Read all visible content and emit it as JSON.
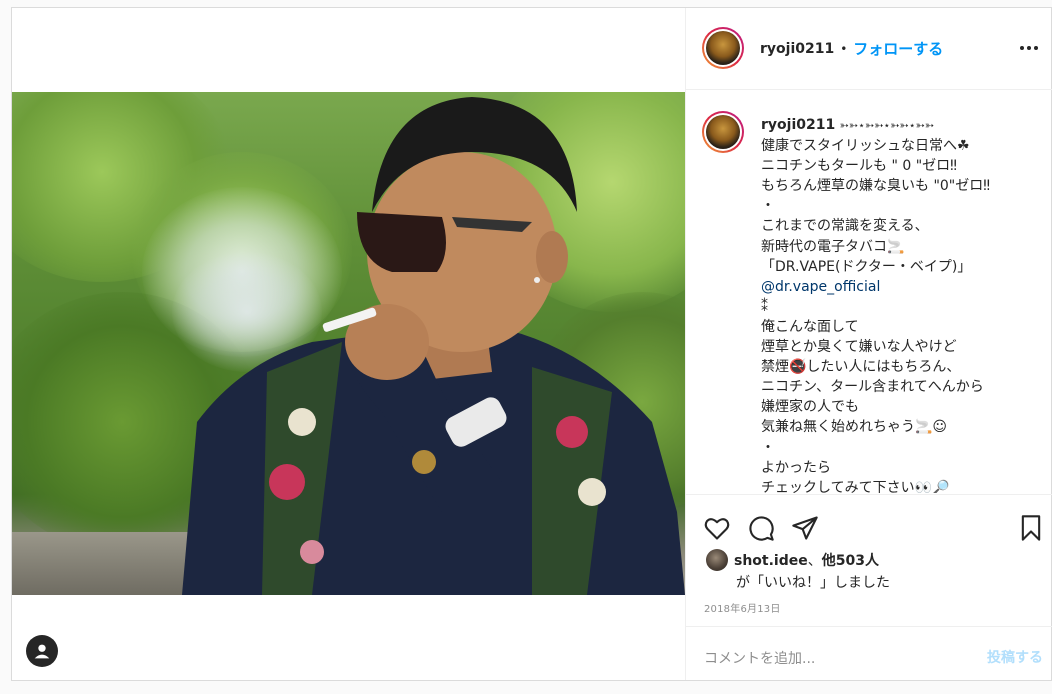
{
  "post": {
    "username": "ryoji0211",
    "header_separator": "•",
    "follow_label": "フォローする",
    "caption_username": "ryoji0211",
    "caption_lines": [
      "➳➳⋆➳➳⋆➳➳⋆➳➳",
      "健康でスタイリッシュな日常へ☘",
      "ニコチンもタールも \" 0 \"ゼロ‼",
      "もちろん煙草の嫌な臭いも \"0\"ゼロ‼",
      "・",
      "これまでの常識を変える、",
      "新時代の電子タバコ🚬",
      "「DR.VAPE(ドクター・ベイプ)」",
      "@dr.vape_official",
      "⁑",
      "俺こんな面して",
      "煙草とか臭くて嫌いな人やけど",
      "禁煙🚭したい人にはもちろん、",
      "ニコチン、タール含まれてへんから",
      "嫌煙家の人でも",
      "気兼ね無く始めれちゃう🚬☺",
      "・",
      "よかったら",
      "チェックしてみて下さい👀🔎"
    ],
    "likes_user": "shot.idee",
    "likes_sep": "、",
    "likes_count": "他503人",
    "likes_suffix": "が「いいね！」しました",
    "date": "2018年6月13日",
    "comment_placeholder": "コメントを追加...",
    "post_button": "投稿する"
  },
  "icons": {
    "more": "more-options-icon",
    "like": "heart-icon",
    "comment": "comment-icon",
    "share": "share-icon",
    "save": "bookmark-icon",
    "account": "account-icon"
  },
  "colors": {
    "link": "#0095f6",
    "mention": "#00376b",
    "muted": "#8e8e8e",
    "post_disabled": "#b2dffc"
  }
}
